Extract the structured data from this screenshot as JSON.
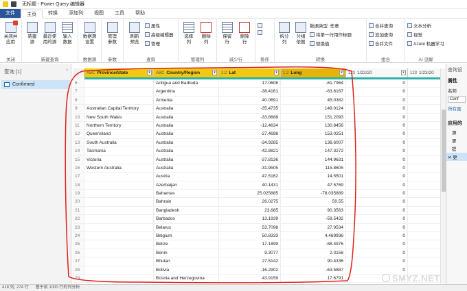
{
  "window": {
    "title": "无标题 - Power Query 编辑器"
  },
  "tabs": [
    "文件",
    "主页",
    "转换",
    "添加列",
    "视图",
    "工具",
    "帮助"
  ],
  "ribbon": {
    "groups": [
      {
        "label": "关闭",
        "buttons": [
          "关闭并\n应用"
        ]
      },
      {
        "label": "新建查询",
        "buttons": [
          "新建\n源",
          "最近使\n用的源",
          "输入\n数据"
        ]
      },
      {
        "label": "数据源",
        "buttons": [
          "数据源\n设置"
        ]
      },
      {
        "label": "参数",
        "buttons": [
          "管理\n参数"
        ]
      },
      {
        "label": "查询",
        "buttons": [
          "刷新\n预览"
        ],
        "small": [
          "属性",
          "高级编辑器",
          "管理"
        ]
      },
      {
        "label": "管理列",
        "buttons": [
          "选择\n列",
          "删除\n列"
        ]
      },
      {
        "label": "减少行",
        "buttons": [
          "保留\n行",
          "删除\n行"
        ]
      },
      {
        "label": "排序",
        "buttons": []
      },
      {
        "label": "转换",
        "buttons": [
          "拆分\n列",
          "分组\n依据"
        ],
        "small": [
          "数据类型: 任意",
          "将第一行用作标题",
          "替换值"
        ]
      },
      {
        "label": "组合",
        "small": [
          "合并查询",
          "追加查询",
          "合并文件"
        ]
      },
      {
        "label": "AI 见解",
        "small": [
          "文本分析",
          "视觉",
          "Azure 机器学习"
        ]
      }
    ]
  },
  "left_pane": {
    "header": "查询 [1]",
    "query": "Confirmed"
  },
  "grid": {
    "columns": [
      {
        "type": "ABC",
        "name": "Province/State"
      },
      {
        "type": "ABC",
        "name": "Country/Region"
      },
      {
        "type": "1.2",
        "name": "Lat"
      },
      {
        "type": "1.2",
        "name": "Long"
      },
      {
        "type": "123",
        "name": "1/22/20"
      },
      {
        "type": "123",
        "name": "1/23/20"
      }
    ],
    "rows": [
      {
        "n": "6",
        "p": "",
        "c": "Antigua and Barbuda",
        "lat": "17.0608",
        "lng": "-61.7964",
        "d": "0"
      },
      {
        "n": "7",
        "p": "",
        "c": "Argentina",
        "lat": "-38.4161",
        "lng": "-63.6167",
        "d": "0"
      },
      {
        "n": "8",
        "p": "",
        "c": "Armenia",
        "lat": "40.0691",
        "lng": "45.0382",
        "d": "0"
      },
      {
        "n": "9",
        "p": "Australian Capital Territory",
        "c": "Australia",
        "lat": "-35.4735",
        "lng": "149.0124",
        "d": "0"
      },
      {
        "n": "10",
        "p": "New South Wales",
        "c": "Australia",
        "lat": "-33.8688",
        "lng": "151.2093",
        "d": "0"
      },
      {
        "n": "11",
        "p": "Northern Territory",
        "c": "Australia",
        "lat": "-12.4634",
        "lng": "130.8456",
        "d": "0"
      },
      {
        "n": "12",
        "p": "Queensland",
        "c": "Australia",
        "lat": "-27.4698",
        "lng": "153.0251",
        "d": "0"
      },
      {
        "n": "13",
        "p": "South Australia",
        "c": "Australia",
        "lat": "-34.9285",
        "lng": "138.6007",
        "d": "0"
      },
      {
        "n": "14",
        "p": "Tasmania",
        "c": "Australia",
        "lat": "-42.8821",
        "lng": "147.3272",
        "d": "0"
      },
      {
        "n": "15",
        "p": "Victoria",
        "c": "Australia",
        "lat": "-37.8136",
        "lng": "144.9631",
        "d": "0"
      },
      {
        "n": "16",
        "p": "Western Australia",
        "c": "Australia",
        "lat": "-31.9505",
        "lng": "115.8605",
        "d": "0"
      },
      {
        "n": "17",
        "p": "",
        "c": "Austria",
        "lat": "47.5162",
        "lng": "14.5501",
        "d": "0"
      },
      {
        "n": "18",
        "p": "",
        "c": "Azerbaijan",
        "lat": "40.1431",
        "lng": "47.5769",
        "d": "0"
      },
      {
        "n": "19",
        "p": "",
        "c": "Bahamas",
        "lat": "25.025885",
        "lng": "-78.035889",
        "d": "0"
      },
      {
        "n": "20",
        "p": "",
        "c": "Bahrain",
        "lat": "26.0275",
        "lng": "50.55",
        "d": "0"
      },
      {
        "n": "21",
        "p": "",
        "c": "Bangladesh",
        "lat": "23.685",
        "lng": "90.3563",
        "d": "0"
      },
      {
        "n": "22",
        "p": "",
        "c": "Barbados",
        "lat": "13.1939",
        "lng": "-59.5432",
        "d": "0"
      },
      {
        "n": "23",
        "p": "",
        "c": "Belarus",
        "lat": "53.7098",
        "lng": "27.9534",
        "d": "0"
      },
      {
        "n": "24",
        "p": "",
        "c": "Belgium",
        "lat": "50.8333",
        "lng": "4.469936",
        "d": "0"
      },
      {
        "n": "25",
        "p": "",
        "c": "Belize",
        "lat": "17.1899",
        "lng": "-88.4976",
        "d": "0"
      },
      {
        "n": "26",
        "p": "",
        "c": "Benin",
        "lat": "9.3077",
        "lng": "2.3158",
        "d": "0"
      },
      {
        "n": "27",
        "p": "",
        "c": "Bhutan",
        "lat": "27.5142",
        "lng": "90.4336",
        "d": "0"
      },
      {
        "n": "28",
        "p": "",
        "c": "Bolivia",
        "lat": "-16.2902",
        "lng": "-63.5887",
        "d": "0"
      },
      {
        "n": "29",
        "p": "",
        "c": "Bosnia and Herzegovina",
        "lat": "43.9159",
        "lng": "17.6791",
        "d": "0"
      }
    ]
  },
  "right_pane": {
    "title": "查询设",
    "section_props": "属性",
    "name_label": "名称",
    "name_value": "Conf",
    "all_props_link": "所有属",
    "section_steps": "应用的",
    "steps": [
      "源",
      "更",
      "提",
      "更"
    ]
  },
  "status": {
    "cols": "418 列, 274 行",
    "note": "基于前 1000 行的列分析"
  },
  "watermark": "SMYZ.NET",
  "colors": {
    "file_tab": "#2b579a",
    "header_yellow": "#f2c811",
    "teal": "#29b3a8",
    "annotation": "#e0201b"
  }
}
